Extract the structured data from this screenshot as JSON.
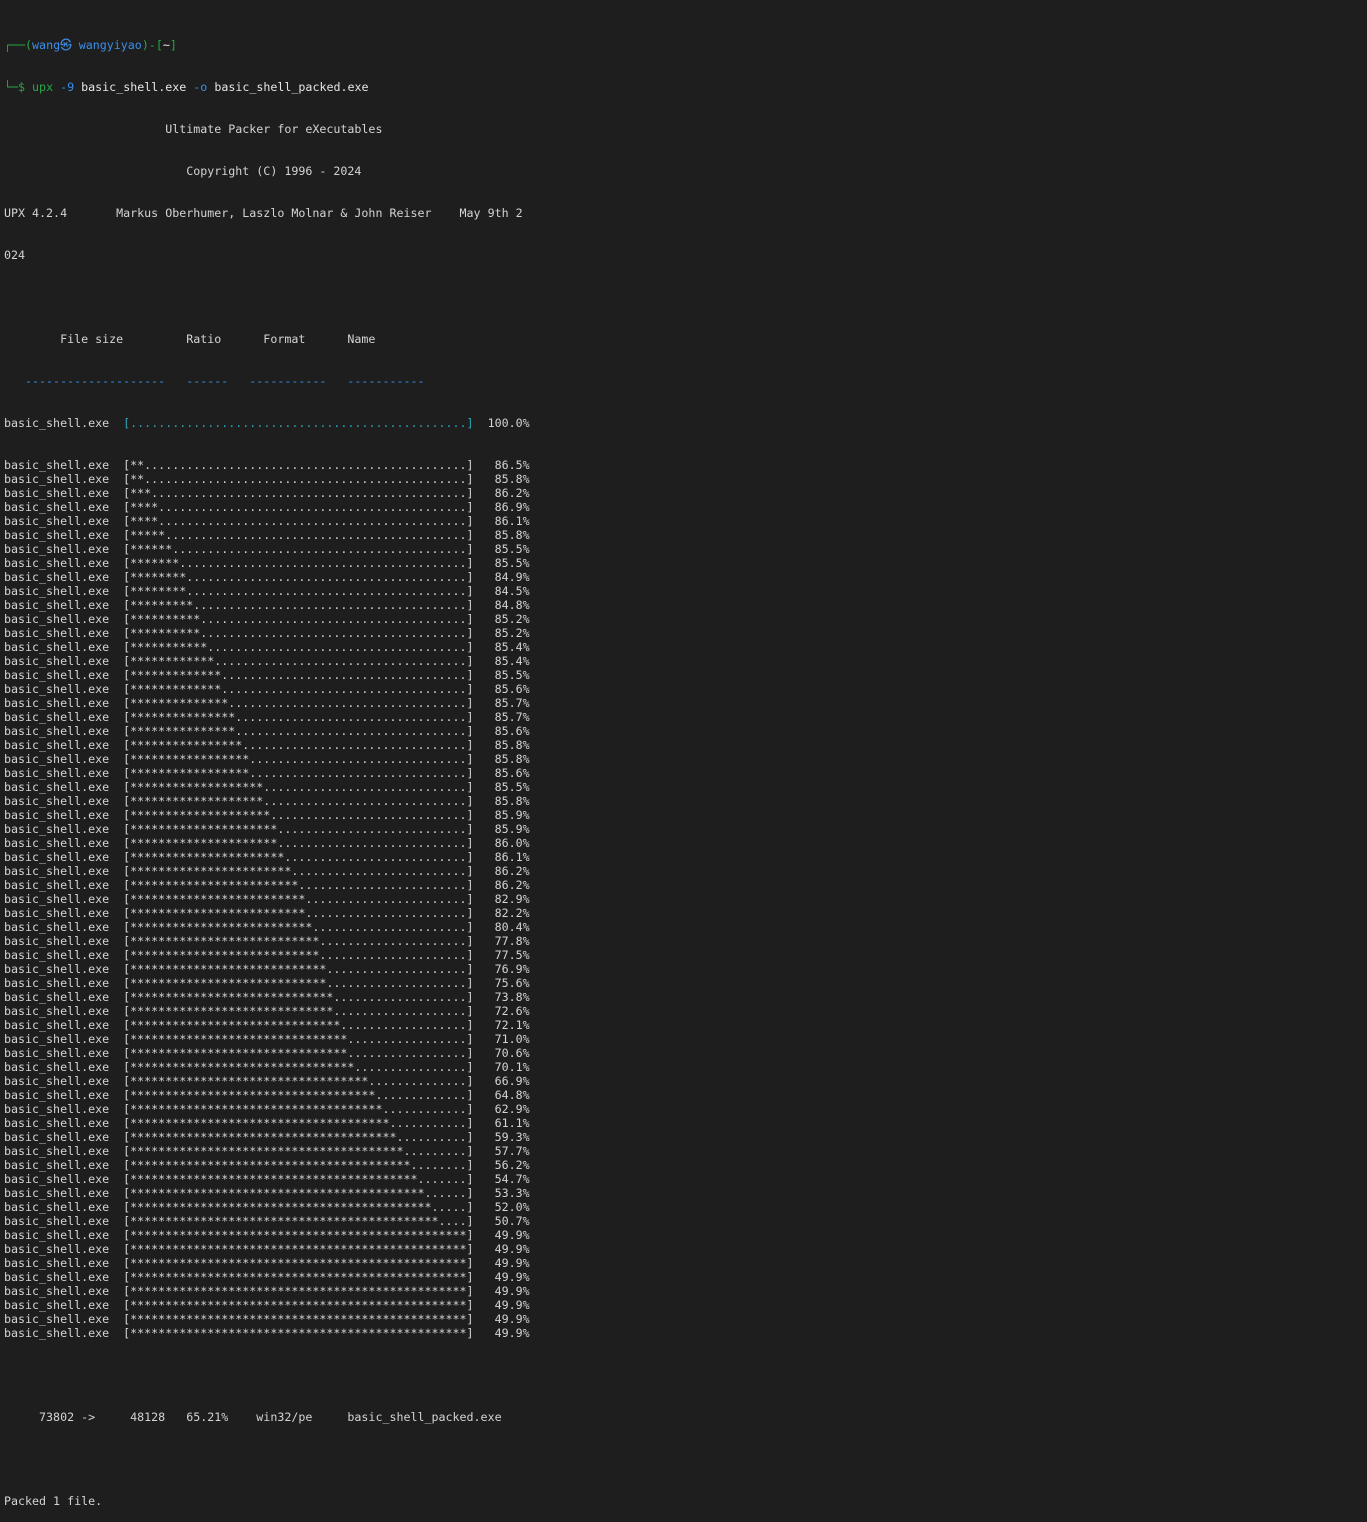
{
  "colors": {
    "background": "#1e1e1e",
    "foreground": "#d4d4d4",
    "prompt_frame": "#27a844",
    "user_host": "#3b8eea",
    "progress_start": "#2aa6b8"
  },
  "prompt": {
    "line1_prefix": "┌──(",
    "user_host": "wang㉿ wangyiyao",
    "line1_mid": ")-[",
    "cwd": "~",
    "line1_suffix": "]",
    "line2_prefix": "└─$ ",
    "cmd": "upx",
    "flag1": "-9",
    "arg1": "basic_shell.exe",
    "flag2": "-o",
    "arg2": "basic_shell_packed.exe"
  },
  "banner": {
    "title": "                       Ultimate Packer for eXecutables",
    "copyright": "                          Copyright (C) 1996 - 2024",
    "version_line": "UPX 4.2.4       Markus Oberhumer, Laszlo Molnar & John Reiser    May 9th 2",
    "version_wrap": "024"
  },
  "table": {
    "header": "        File size         Ratio      Format      Name",
    "separator": "   --------------------   ------   -----------   -----------"
  },
  "progress": {
    "filename": "basic_shell.exe",
    "first_line": "basic_shell.exe  [................................................]  100.0%",
    "lines": [
      "basic_shell.exe  [**..............................................]   86.5%",
      "basic_shell.exe  [**..............................................]   85.8%",
      "basic_shell.exe  [***.............................................]   86.2%",
      "basic_shell.exe  [****............................................]   86.9%",
      "basic_shell.exe  [****............................................]   86.1%",
      "basic_shell.exe  [*****...........................................]   85.8%",
      "basic_shell.exe  [******..........................................]   85.5%",
      "basic_shell.exe  [*******.........................................]   85.5%",
      "basic_shell.exe  [********........................................]   84.9%",
      "basic_shell.exe  [********........................................]   84.5%",
      "basic_shell.exe  [*********.......................................]   84.8%",
      "basic_shell.exe  [**********......................................]   85.2%",
      "basic_shell.exe  [**********......................................]   85.2%",
      "basic_shell.exe  [***********.....................................]   85.4%",
      "basic_shell.exe  [************....................................]   85.4%",
      "basic_shell.exe  [*************...................................]   85.5%",
      "basic_shell.exe  [*************...................................]   85.6%",
      "basic_shell.exe  [**************..................................]   85.7%",
      "basic_shell.exe  [***************.................................]   85.7%",
      "basic_shell.exe  [***************.................................]   85.6%",
      "basic_shell.exe  [****************................................]   85.8%",
      "basic_shell.exe  [*****************...............................]   85.8%",
      "basic_shell.exe  [*****************...............................]   85.6%",
      "basic_shell.exe  [*******************.............................]   85.5%",
      "basic_shell.exe  [*******************.............................]   85.8%",
      "basic_shell.exe  [********************............................]   85.9%",
      "basic_shell.exe  [*********************...........................]   85.9%",
      "basic_shell.exe  [*********************...........................]   86.0%",
      "basic_shell.exe  [**********************..........................]   86.1%",
      "basic_shell.exe  [***********************.........................]   86.2%",
      "basic_shell.exe  [************************........................]   86.2%",
      "basic_shell.exe  [*************************.......................]   82.9%",
      "basic_shell.exe  [*************************.......................]   82.2%",
      "basic_shell.exe  [**************************......................]   80.4%",
      "basic_shell.exe  [***************************.....................]   77.8%",
      "basic_shell.exe  [***************************.....................]   77.5%",
      "basic_shell.exe  [****************************....................]   76.9%",
      "basic_shell.exe  [****************************....................]   75.6%",
      "basic_shell.exe  [*****************************...................]   73.8%",
      "basic_shell.exe  [*****************************...................]   72.6%",
      "basic_shell.exe  [******************************..................]   72.1%",
      "basic_shell.exe  [*******************************.................]   71.0%",
      "basic_shell.exe  [*******************************.................]   70.6%",
      "basic_shell.exe  [********************************................]   70.1%",
      "basic_shell.exe  [**********************************..............]   66.9%",
      "basic_shell.exe  [***********************************.............]   64.8%",
      "basic_shell.exe  [************************************............]   62.9%",
      "basic_shell.exe  [*************************************...........]   61.1%",
      "basic_shell.exe  [**************************************..........]   59.3%",
      "basic_shell.exe  [***************************************.........]   57.7%",
      "basic_shell.exe  [****************************************........]   56.2%",
      "basic_shell.exe  [*****************************************.......]   54.7%",
      "basic_shell.exe  [******************************************......]   53.3%",
      "basic_shell.exe  [*******************************************.....]   52.0%",
      "basic_shell.exe  [********************************************....]   50.7%",
      "basic_shell.exe  [************************************************]   49.9%",
      "basic_shell.exe  [************************************************]   49.9%",
      "basic_shell.exe  [************************************************]   49.9%",
      "basic_shell.exe  [************************************************]   49.9%",
      "basic_shell.exe  [************************************************]   49.9%",
      "basic_shell.exe  [************************************************]   49.9%",
      "basic_shell.exe  [************************************************]   49.9%",
      "basic_shell.exe  [************************************************]   49.9%"
    ]
  },
  "summary": {
    "result_line": "     73802 ->     48128   65.21%    win32/pe     basic_shell_packed.exe",
    "final": "Packed 1 file."
  }
}
